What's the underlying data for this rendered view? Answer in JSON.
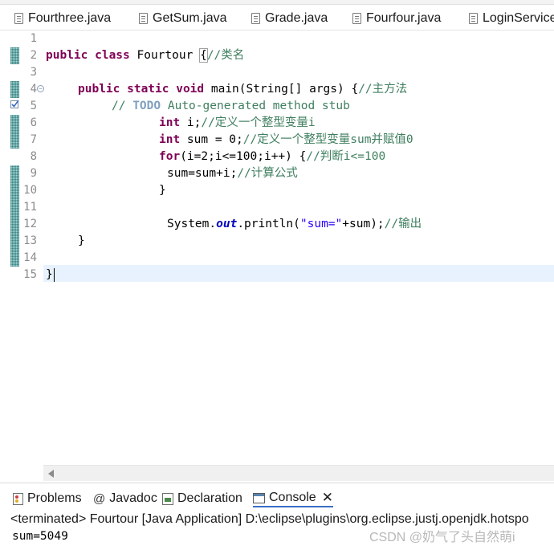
{
  "editor_tabs": [
    {
      "label": "Fourthree.java"
    },
    {
      "label": "GetSum.java"
    },
    {
      "label": "Grade.java"
    },
    {
      "label": "Fourfour.java"
    },
    {
      "label": "LoginService"
    }
  ],
  "code": {
    "line_numbers": [
      "1",
      "2",
      "3",
      "4",
      "5",
      "6",
      "7",
      "8",
      "9",
      "10",
      "11",
      "12",
      "13",
      "14",
      "15"
    ],
    "l2": {
      "kw": "public class",
      "name": " Fourtour ",
      "brace": "{",
      "comment": "//类名"
    },
    "l4": {
      "kw": "public static void",
      "sig": " main(String[] args) {",
      "comment": "//主方法"
    },
    "l5": {
      "prefix": "// ",
      "todo": "TODO",
      "rest": " Auto-generated method stub"
    },
    "l6": {
      "kw": "int",
      "code": " i;",
      "comment": "//定义一个整型变量i"
    },
    "l7": {
      "kw": "int",
      "code": " sum = 0;",
      "comment": "//定义一个整型变量sum并赋值0"
    },
    "l8": {
      "kw": "for",
      "code": "(i=2;i<=100;i++) {",
      "comment": "//判断i<=100"
    },
    "l9": {
      "code": "sum=sum+i;",
      "comment": "//计算公式"
    },
    "l10": {
      "code": "}"
    },
    "l12": {
      "pre": "System.",
      "field": "out",
      "call": ".println(",
      "str": "\"sum=\"",
      "post": "+sum);",
      "comment": "//输出"
    },
    "l13": {
      "code": "}"
    },
    "l15": {
      "code": "}"
    }
  },
  "panel": {
    "tabs": [
      {
        "label": "Problems"
      },
      {
        "label": "Javadoc"
      },
      {
        "label": "Declaration"
      },
      {
        "label": "Console"
      }
    ],
    "javadoc_glyph": "@",
    "close_glyph": "✕",
    "status": "<terminated> Fourtour [Java Application] D:\\eclipse\\plugins\\org.eclipse.justj.openjdk.hotspo",
    "output": "sum=5049",
    "watermark": "CSDN @奶气了头自然萌i"
  },
  "colors": {
    "keyword": "#7f0055",
    "comment": "#3f7f5f",
    "string": "#2a00ff",
    "field": "#0000c0",
    "current_line": "#e8f2fe"
  }
}
